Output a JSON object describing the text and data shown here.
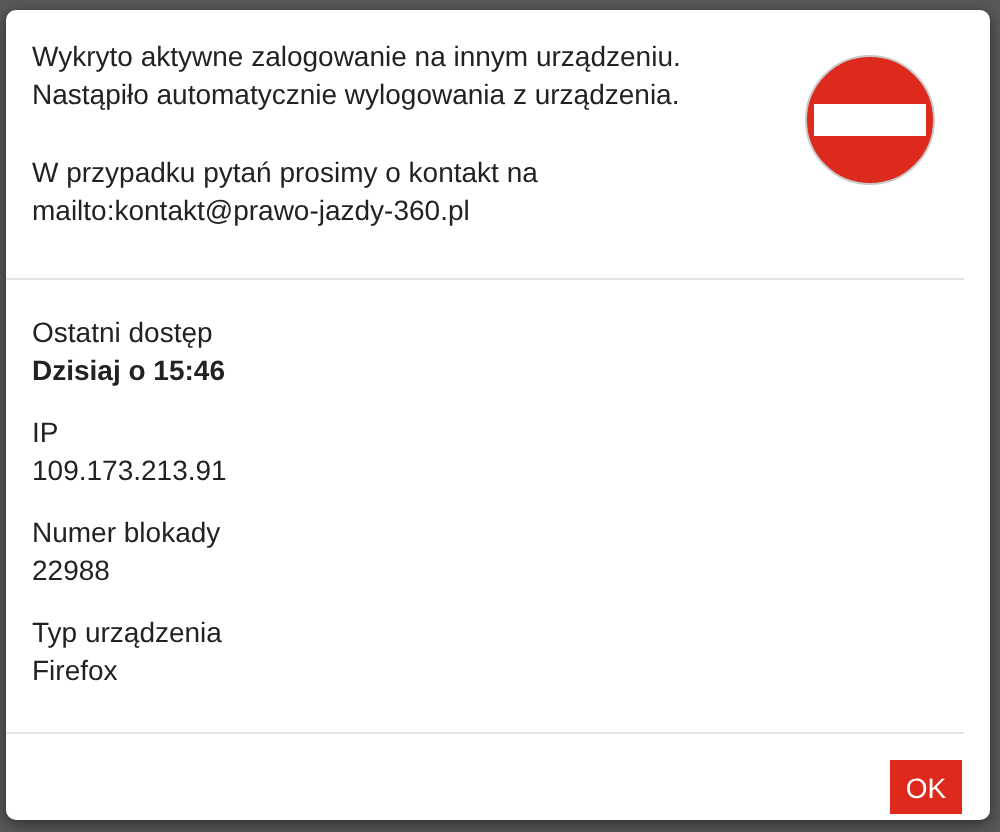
{
  "message": {
    "paragraphs": [
      [
        "Wykryto aktywne zalogowanie na innym urządzeniu.",
        "Nastąpiło automatycznie wylogowania z urządzenia."
      ],
      [
        "W przypadku pytań prosimy o kontakt na",
        "mailto:kontakt@prawo-jazdy-360.pl"
      ]
    ]
  },
  "details": [
    {
      "label": "Ostatni dostęp",
      "value": "Dzisiaj o 15:46",
      "bold": true
    },
    {
      "label": "IP",
      "value": "109.173.213.91",
      "bold": false
    },
    {
      "label": "Numer blokady",
      "value": "22988",
      "bold": false
    },
    {
      "label": "Typ urządzenia",
      "value": "Firefox",
      "bold": false
    }
  ],
  "buttons": [
    "OK"
  ]
}
